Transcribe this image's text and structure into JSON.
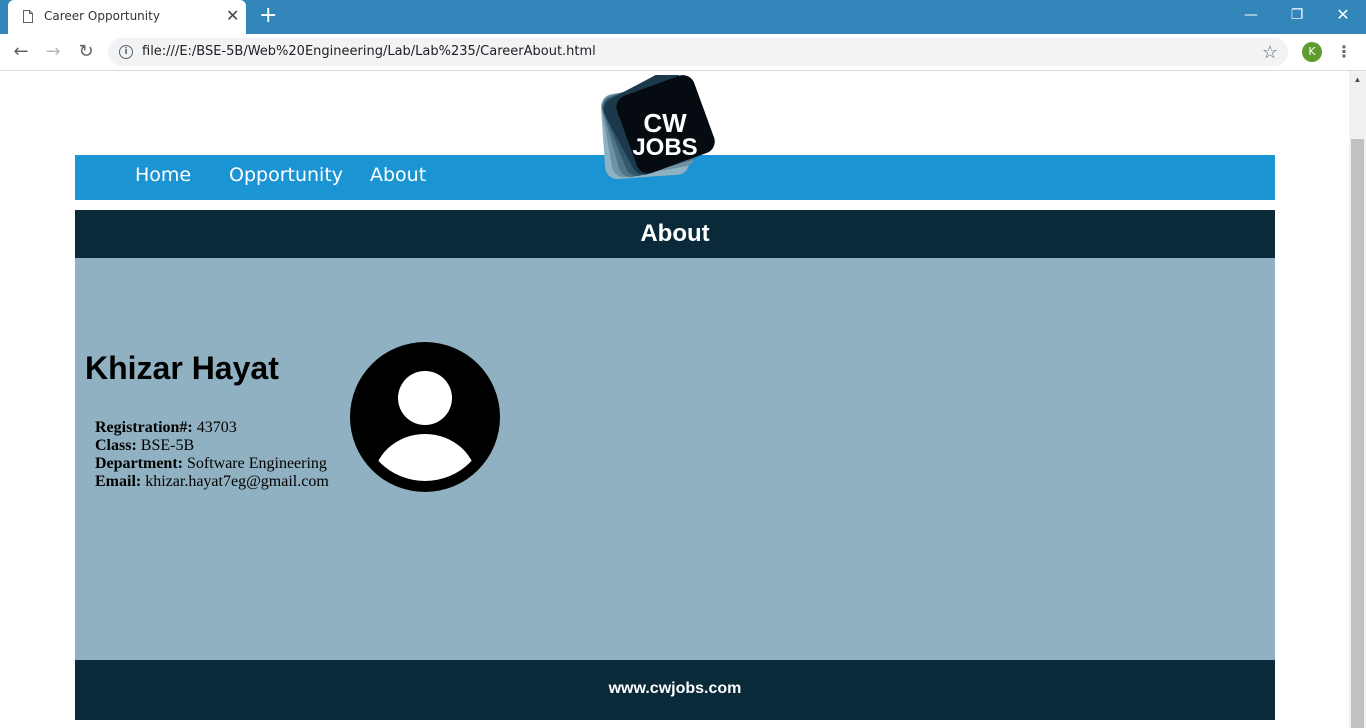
{
  "browser": {
    "tab_title": "Career Opportunity",
    "url": "file:///E:/BSE-5B/Web%20Engineering/Lab/Lab%235/CareerAbout.html",
    "profile_initial": "K"
  },
  "logo": {
    "line1": "CW",
    "line2": "JOBS"
  },
  "nav": {
    "items": [
      {
        "label": "Home"
      },
      {
        "label": "Opportunity"
      },
      {
        "label": "About"
      }
    ]
  },
  "section": {
    "title": "About"
  },
  "profile": {
    "name": "Khizar Hayat",
    "fields": [
      {
        "label": "Registration#:",
        "value": "43703"
      },
      {
        "label": "Class:",
        "value": "BSE-5B"
      },
      {
        "label": "Department:",
        "value": "Software Engineering"
      },
      {
        "label": "Email:",
        "value": "khizar.hayat7eg@gmail.com"
      }
    ]
  },
  "footer": {
    "text": "www.cwjobs.com"
  },
  "colors": {
    "tabbar": "#3286ba",
    "navbar": "#1b94d3",
    "header": "#0a2a3a",
    "content": "#90b1c1"
  }
}
